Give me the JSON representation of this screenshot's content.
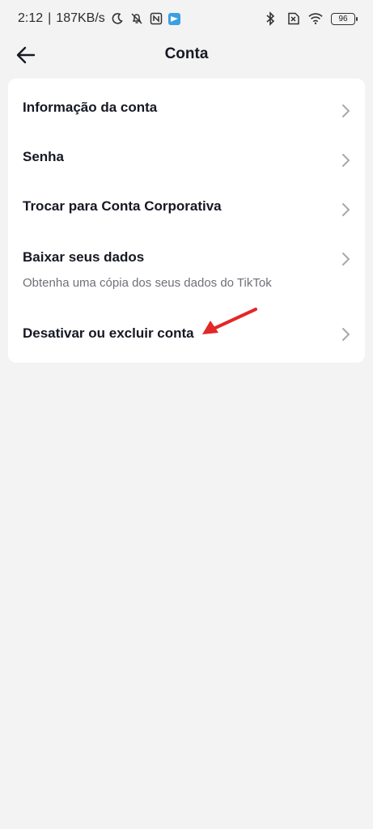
{
  "status_bar": {
    "time": "2:12",
    "separator": "|",
    "speed": "187KB/s",
    "battery": "96"
  },
  "header": {
    "back_icon": "arrow-left-icon",
    "title": "Conta"
  },
  "menu": {
    "items": [
      {
        "label": "Informação da conta"
      },
      {
        "label": "Senha"
      },
      {
        "label": "Trocar para Conta Corporativa"
      },
      {
        "label": "Baixar seus dados",
        "sublabel": "Obtenha uma cópia dos seus dados do TikTok"
      },
      {
        "label": "Desativar ou excluir conta"
      }
    ]
  },
  "annotation": {
    "color": "#e32727"
  }
}
